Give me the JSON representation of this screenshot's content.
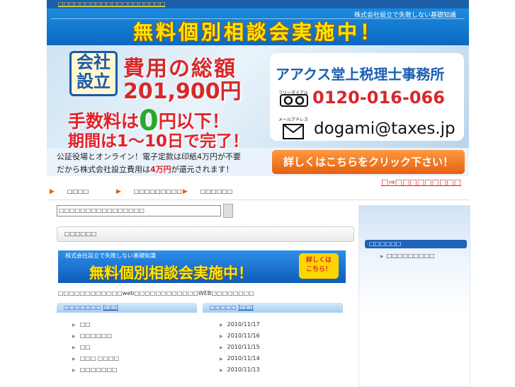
{
  "top": {
    "link": "□□□□□□□□□□□□□□□□□□□□"
  },
  "header1": {
    "subtitle": "株式会社設立で失敗しない基礎知識",
    "title": "無料個別相談会実施中！"
  },
  "header2": {
    "badge_line1": "会社",
    "badge_line2": "設立",
    "total_label": "費用の総額",
    "total_amount": "201,900円",
    "fee_pre": "手数料は",
    "fee_zero": "0",
    "fee_post": "円以下！",
    "period": "期間は1～10日で完了！",
    "office_name": "アアクス堂上税理士事務所",
    "freedial_label": "フリーダイアル",
    "phone": "0120-016-066",
    "mail_label": "メールアドレス",
    "email": "dogami@taxes.jp"
  },
  "header3": {
    "line1": "公証役場とオンライン！電子定款は印紙4万円が不要",
    "line2_pre": "だから株式会社設立費用は",
    "line2_em": "4万円",
    "line2_post": "が還元されます！",
    "button": "詳しくはこちらをクリック下さい！"
  },
  "red_link": "□⇒□□□□□□□□□",
  "nav": [
    "□□□□",
    "□□□□□□□□□",
    "□□□□□□"
  ],
  "search": {
    "value": "□□□□□□□□□□□□□□□□"
  },
  "section_bar": "□□□□□□",
  "banner": {
    "small": "株式会社設立で失敗しない基礎知識",
    "large": "無料個別相談会実施中！",
    "badge": "詳しくは\nこちら！"
  },
  "note": "□□□□□□□□□□□□web□□□□□□□□□□□□WEB□□□□□□□□",
  "left_col": {
    "header": "□□□□□□□",
    "header_link": "[□□]",
    "items": [
      "□□",
      "□□□□□□",
      "□□",
      "□□□ □□□□",
      "□□□□□□□"
    ]
  },
  "right_col": {
    "header": "□□□□□",
    "header_link": "[□□]",
    "items": [
      "2010/11/17",
      "2010/11/16",
      "2010/11/15",
      "2010/11/14",
      "2010/11/13"
    ]
  },
  "sidebar": {
    "header": "□□□□□□",
    "item": "□□□□□□□□□"
  }
}
